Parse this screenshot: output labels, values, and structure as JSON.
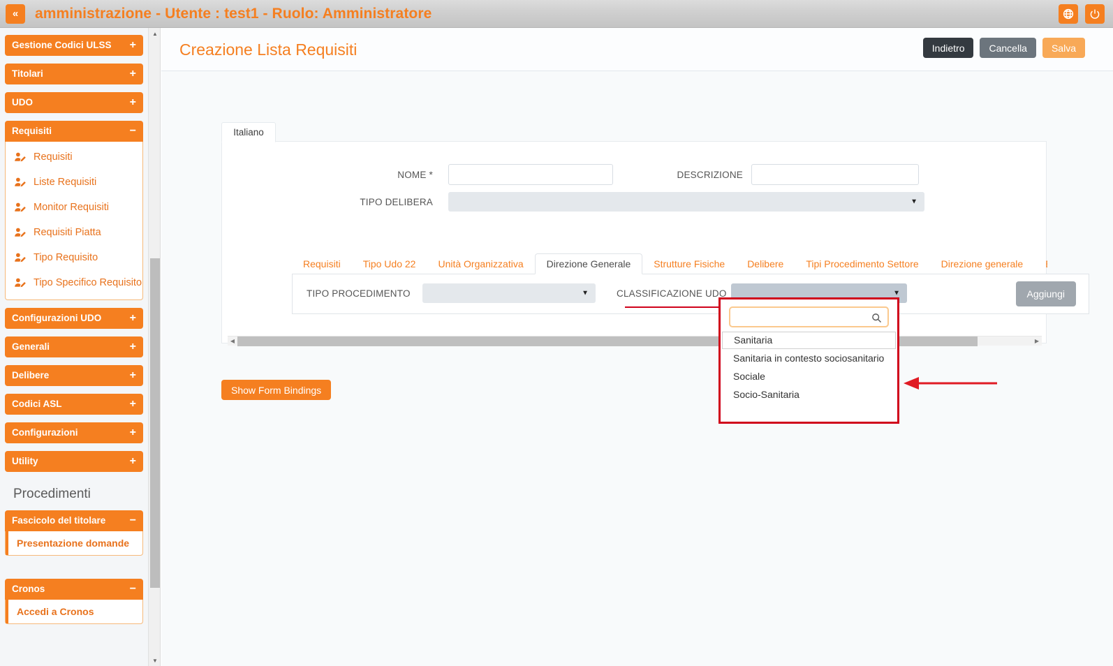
{
  "topbar": {
    "collapse_label": "«",
    "title": "amministrazione - Utente : test1 - Ruolo: Amministratore",
    "globe_icon": "globe-icon",
    "power_icon": "power-icon"
  },
  "sidebar": {
    "groups": [
      {
        "label": "Gestione Codici ULSS",
        "sign": "+",
        "open": false,
        "items": []
      },
      {
        "label": "Titolari",
        "sign": "+",
        "open": false,
        "items": []
      },
      {
        "label": "UDO",
        "sign": "+",
        "open": false,
        "items": []
      },
      {
        "label": "Requisiti",
        "sign": "−",
        "open": true,
        "items": [
          {
            "label": "Requisiti",
            "icon": "user-edit-icon"
          },
          {
            "label": "Liste Requisiti",
            "icon": "user-edit-icon"
          },
          {
            "label": "Monitor Requisiti",
            "icon": "user-edit-icon"
          },
          {
            "label": "Requisiti Piatta",
            "icon": "user-edit-icon"
          },
          {
            "label": "Tipo Requisito",
            "icon": "user-edit-icon"
          },
          {
            "label": "Tipo Specifico Requisito",
            "icon": "user-edit-icon"
          }
        ]
      },
      {
        "label": "Configurazioni UDO",
        "sign": "+",
        "open": false,
        "items": []
      },
      {
        "label": "Generali",
        "sign": "+",
        "open": false,
        "items": []
      },
      {
        "label": "Delibere",
        "sign": "+",
        "open": false,
        "items": []
      },
      {
        "label": "Codici ASL",
        "sign": "+",
        "open": false,
        "items": []
      },
      {
        "label": "Configurazioni",
        "sign": "+",
        "open": false,
        "items": []
      },
      {
        "label": "Utility",
        "sign": "+",
        "open": false,
        "items": []
      }
    ],
    "section_title": "Procedimenti",
    "fascicolo": {
      "label": "Fascicolo del titolare",
      "sign": "−",
      "item": "Presentazione domande"
    },
    "cronos": {
      "label": "Cronos",
      "sign": "−",
      "item": "Accedi a Cronos"
    },
    "scroll_up_icon": "chevron-up-icon",
    "scroll_down_icon": "chevron-down-icon"
  },
  "header": {
    "title": "Creazione Lista Requisiti",
    "buttons": [
      {
        "label": "Indietro",
        "style": "dark"
      },
      {
        "label": "Cancella",
        "style": "grey"
      },
      {
        "label": "Salva",
        "style": "orange"
      }
    ]
  },
  "form": {
    "language_tab": "Italiano",
    "nome_label": "NOME *",
    "nome_value": "",
    "descrizione_label": "DESCRIZIONE",
    "descrizione_value": "",
    "tipo_delibera_label": "TIPO DELIBERA",
    "tipo_delibera_value": "",
    "caret_icon": "chevron-down-icon"
  },
  "tabs": [
    {
      "label": "Requisiti",
      "active": false
    },
    {
      "label": "Tipo Udo 22",
      "active": false
    },
    {
      "label": "Unità Organizzativa",
      "active": false
    },
    {
      "label": "Direzione Generale",
      "active": true
    },
    {
      "label": "Strutture Fisiche",
      "active": false
    },
    {
      "label": "Delibere",
      "active": false
    },
    {
      "label": "Tipi Procedimento Settore",
      "active": false
    },
    {
      "label": "Direzione generale",
      "active": false
    },
    {
      "label": "Edifi",
      "active": false
    }
  ],
  "tabpanel": {
    "tipo_procedimento_label": "TIPO PROCEDIMENTO",
    "tipo_procedimento_value": "",
    "classificazione_udo_label": "CLASSIFICAZIONE UDO",
    "classificazione_udo_value": "",
    "aggiungi_label": "Aggiungi"
  },
  "dropdown": {
    "search_value": "",
    "search_icon": "search-icon",
    "options": [
      {
        "label": "Sanitaria",
        "selected": true
      },
      {
        "label": "Sanitaria in contesto sociosanitario",
        "selected": false
      },
      {
        "label": "Sociale",
        "selected": false
      },
      {
        "label": "Socio-Sanitaria",
        "selected": false
      }
    ]
  },
  "footer": {
    "show_bindings_label": "Show Form Bindings"
  },
  "annotation": {
    "arrow_color": "#d0021b",
    "highlight_color": "#d0021b"
  },
  "colors": {
    "accent_orange": "#f57f20",
    "dark_button": "#343a40",
    "grey_button": "#6c757d",
    "save_button": "#f8a957",
    "annotation_red": "#d0021b"
  }
}
